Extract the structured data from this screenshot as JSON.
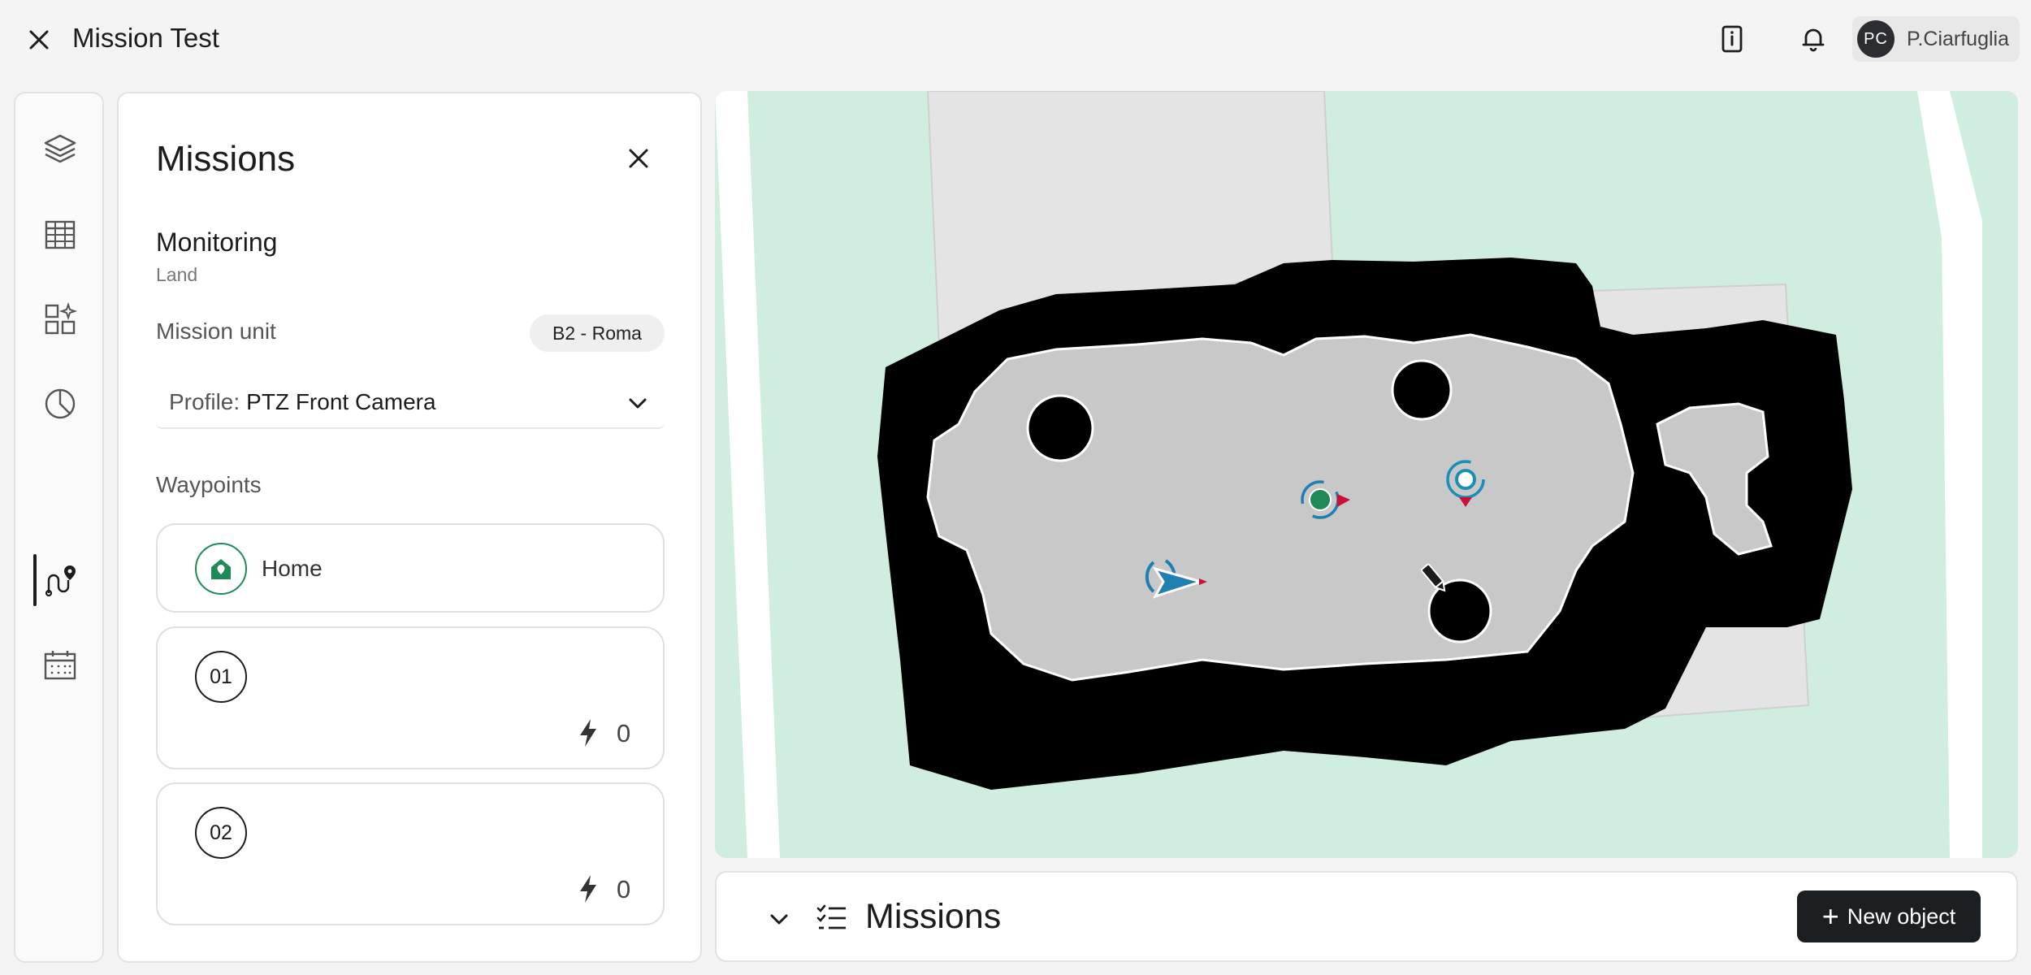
{
  "header": {
    "title": "Mission Test",
    "user_initials": "PC",
    "user_name": "P.Ciarfuglia"
  },
  "sidebar_rail": {
    "items": [
      {
        "name": "layers",
        "icon": "layers-icon"
      },
      {
        "name": "table",
        "icon": "table-icon"
      },
      {
        "name": "widgets",
        "icon": "widgets-icon"
      },
      {
        "name": "analytics",
        "icon": "pie-chart-icon"
      },
      {
        "name": "missions",
        "icon": "route-icon",
        "active": true
      },
      {
        "name": "calendar",
        "icon": "calendar-icon"
      }
    ]
  },
  "panel": {
    "title": "Missions",
    "mission_name": "Monitoring",
    "mission_type": "Land",
    "unit_label": "Mission unit",
    "unit_value": "B2 - Roma",
    "profile_prefix": "Profile:",
    "profile_value": "PTZ Front Camera",
    "waypoints_label": "Waypoints",
    "waypoints": [
      {
        "label": "Home",
        "kind": "home"
      },
      {
        "number": "01",
        "actions": "0"
      },
      {
        "number": "02",
        "actions": "0"
      }
    ]
  },
  "bottom_bar": {
    "title": "Missions",
    "new_button_label": "New object"
  },
  "colors": {
    "map_background": "#d0eee0",
    "occupancy_black": "#000000",
    "free_space": "#c8c8c8",
    "robot_blue": "#1f7fb0",
    "home_green": "#1e8a58",
    "heading_red": "#c8103a",
    "waypoint_cyan": "#1a8fb5"
  }
}
